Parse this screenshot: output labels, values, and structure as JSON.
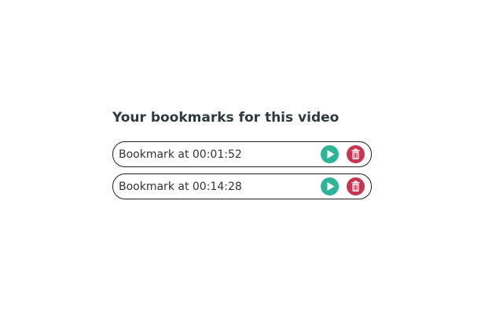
{
  "heading": "Your bookmarks for this video",
  "colors": {
    "play": "#2bb596",
    "delete": "#c9344f"
  },
  "bookmarks": [
    {
      "label": "Bookmark at 00:01:52",
      "play_icon": "play-icon",
      "delete_icon": "trash-icon"
    },
    {
      "label": "Bookmark at 00:14:28",
      "play_icon": "play-icon",
      "delete_icon": "trash-icon"
    }
  ]
}
